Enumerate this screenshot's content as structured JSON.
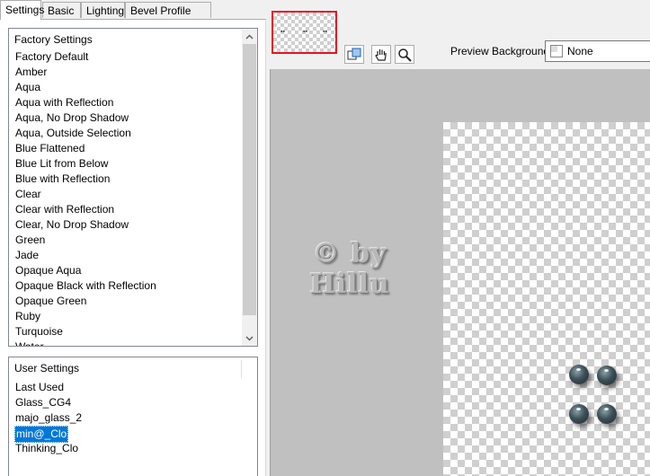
{
  "tabs": [
    {
      "label": "Settings",
      "active": true
    },
    {
      "label": "Basic",
      "active": false
    },
    {
      "label": "Lighting",
      "active": false
    },
    {
      "label": "Bevel Profile",
      "active": false
    }
  ],
  "factory_settings": {
    "header": "Factory Settings",
    "items": [
      "Factory Default",
      "Amber",
      "Aqua",
      "Aqua with Reflection",
      "Aqua, No Drop Shadow",
      "Aqua, Outside Selection",
      "Blue Flattened",
      "Blue Lit from Below",
      "Blue with Reflection",
      "Clear",
      "Clear with Reflection",
      "Clear, No Drop Shadow",
      "Green",
      "Jade",
      "Opaque Aqua",
      "Opaque Black with Reflection",
      "Opaque Green",
      "Ruby",
      "Turquoise",
      "Water"
    ]
  },
  "user_settings": {
    "header": "User Settings",
    "items": [
      "Last Used",
      "Glass_CG4",
      "majo_glass_2",
      "min@_Clo",
      "Thinking_Clo"
    ],
    "selected": "min@_Clo"
  },
  "toolbar": {
    "buttons": [
      "pan-zoom-icon",
      "hand-icon",
      "magnifier-icon"
    ]
  },
  "preview_background": {
    "label": "Preview Background:",
    "value": "None"
  },
  "watermark": {
    "line1": "© by",
    "line2": "Hillu"
  }
}
